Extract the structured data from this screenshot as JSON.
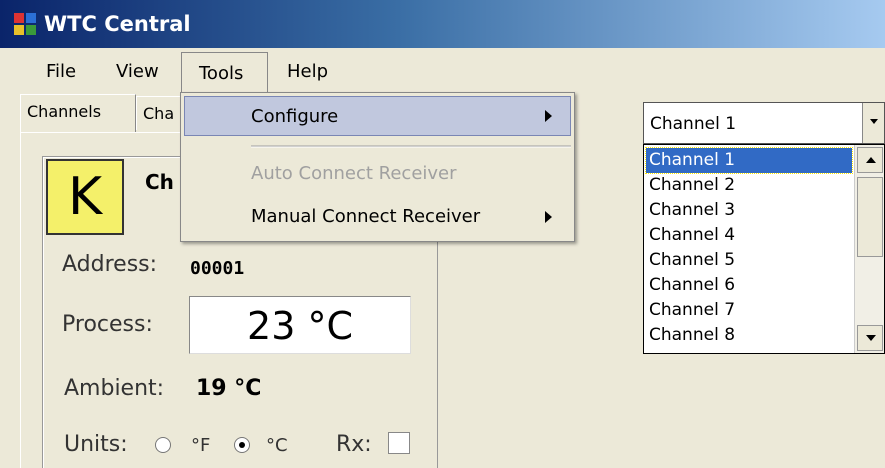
{
  "window": {
    "title": "WTC Central"
  },
  "menubar": {
    "file": "File",
    "view": "View",
    "tools": "Tools",
    "help": "Help"
  },
  "tabs": [
    {
      "label": "Channels"
    },
    {
      "label": "Cha"
    }
  ],
  "tools_menu": {
    "items": [
      {
        "label": "Configure",
        "has_submenu": true,
        "highlighted": true
      },
      {
        "label": "Auto Connect Receiver",
        "enabled": false
      },
      {
        "label": "Manual Connect Receiver",
        "has_submenu": true
      }
    ]
  },
  "channel_panel": {
    "type_badge": "K",
    "channel_label": "Ch",
    "address_label": "Address:",
    "address_value": "00001",
    "process_label": "Process:",
    "process_value": "23 °C",
    "ambient_label": "Ambient:",
    "ambient_value": "19 °C",
    "units_label": "Units:",
    "unit_f": "°F",
    "unit_c": "°C",
    "selected_unit": "°C",
    "rx_label": "Rx:",
    "rx_checked": false
  },
  "channel_select": {
    "selected": "Channel 1",
    "options": [
      "Channel 1",
      "Channel 2",
      "Channel 3",
      "Channel 4",
      "Channel 5",
      "Channel 6",
      "Channel 7",
      "Channel 8"
    ]
  },
  "colors": {
    "titlebar": "#0a246a",
    "selection": "#316ac5",
    "badge": "#f4f06a",
    "menu_highlight": "#c1c8de"
  }
}
